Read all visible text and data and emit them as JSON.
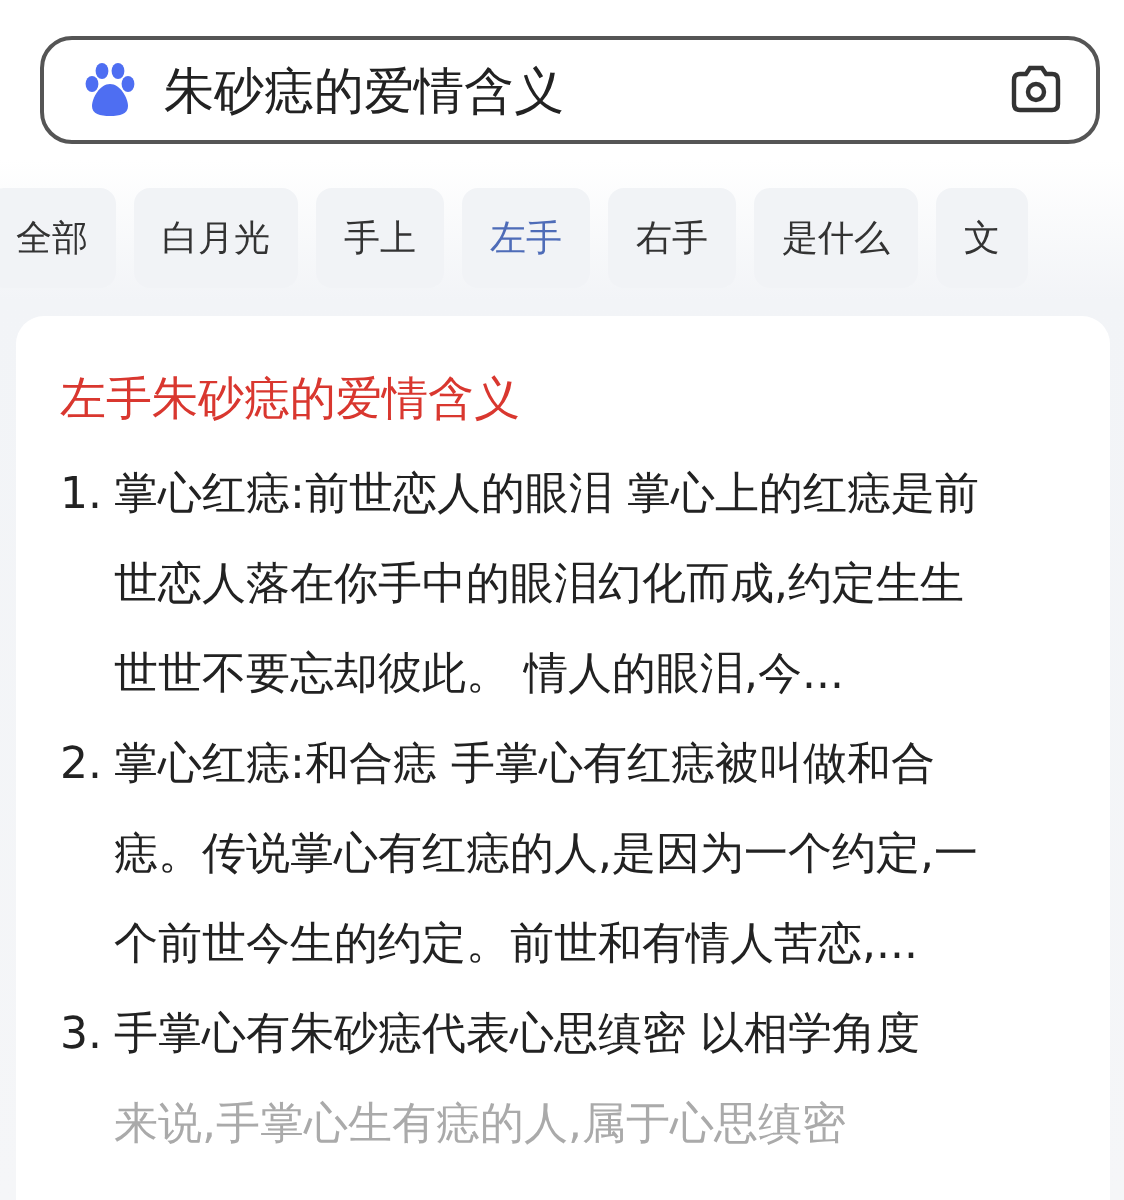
{
  "search": {
    "value": "朱砂痣的爱情含义"
  },
  "tabs": [
    {
      "label": "全部",
      "selected": false
    },
    {
      "label": "白月光",
      "selected": false
    },
    {
      "label": "手上",
      "selected": false
    },
    {
      "label": "左手",
      "selected": true
    },
    {
      "label": "右手",
      "selected": false
    },
    {
      "label": "是什么",
      "selected": false
    },
    {
      "label": "文",
      "selected": false
    }
  ],
  "result": {
    "title": "左手朱砂痣的爱情含义",
    "items": [
      {
        "number": "1.",
        "text": "掌心红痣:前世恋人的眼泪 掌心上的红痣是前世恋人落在你手中的眼泪幻化而成,约定生生世世不要忘却彼此。 情人的眼泪,今..."
      },
      {
        "number": "2.",
        "text": "掌心红痣:和合痣 手掌心有红痣被叫做和合痣。传说掌心有红痣的人,是因为一个约定,一个前世今生的约定。前世和有情人苦恋,..."
      },
      {
        "number": "3.",
        "text": "手掌心有朱砂痣代表心思缜密 以相学角度",
        "faded_text": "来说,手掌心生有痣的人,属于心思缜密"
      }
    ]
  }
}
